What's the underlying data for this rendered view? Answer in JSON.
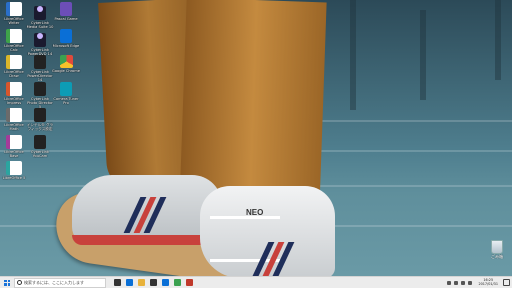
{
  "desktop": {
    "icons": [
      {
        "label": "LibreOffice Writer",
        "icon": "libreoffice-writer-icon",
        "cls": "lo-writer"
      },
      {
        "label": "CyberLink Media Suite 10",
        "icon": "cyberlink-media-suite-icon",
        "cls": "cyber"
      },
      {
        "label": "Pascal Game",
        "icon": "pascal-game-icon",
        "cls": "ps"
      },
      {
        "label": "LibreOffice Calc",
        "icon": "libreoffice-calc-icon",
        "cls": "lo-calc"
      },
      {
        "label": "CyberLink PowerDVD 14",
        "icon": "cyberlink-powerdvd-icon",
        "cls": "cyber"
      },
      {
        "label": "Microsoft Edge",
        "icon": "microsoft-edge-icon",
        "cls": "edge"
      },
      {
        "label": "LibreOffice Draw",
        "icon": "libreoffice-draw-icon",
        "cls": "lo-draw"
      },
      {
        "label": "CyberLink PowerDirector 14",
        "icon": "cyberlink-powerdirector-icon",
        "cls": "prem"
      },
      {
        "label": "Google Chrome",
        "icon": "google-chrome-icon",
        "cls": "chrome"
      },
      {
        "label": "LibreOffice Impress",
        "icon": "libreoffice-impress-icon",
        "cls": "lo-impress"
      },
      {
        "label": "CyberLink Photo Director 5",
        "icon": "cyberlink-photodirector-icon",
        "cls": "prem"
      },
      {
        "label": "Camera Tuner Pro",
        "icon": "camera-app-icon",
        "cls": "cam"
      },
      {
        "label": "LibreOffice Math",
        "icon": "libreoffice-math-icon",
        "cls": "lo-math"
      },
      {
        "label": "インテル® グラフィックス設定",
        "icon": "cyberlink-app-icon",
        "cls": "prem"
      },
      {
        "label": "LibreOffice Base",
        "icon": "libreoffice-base-icon",
        "cls": "lo-base"
      },
      {
        "label": "CyberLink YouCam",
        "icon": "cyberlink-youcam-icon",
        "cls": "prem"
      },
      {
        "label": "LibreOffice 5",
        "icon": "libreoffice-icon",
        "cls": "lo-main"
      }
    ],
    "recycle_bin": {
      "label": "ごみ箱",
      "icon": "recycle-bin-icon"
    },
    "wallpaper": {
      "logo_text": "NEO"
    }
  },
  "taskbar": {
    "search_placeholder": "検索するには、ここに入力します",
    "pinned": [
      {
        "icon": "task-view-icon",
        "color": "#333333"
      },
      {
        "icon": "edge-taskbar-icon",
        "color": "#0a6fd6"
      },
      {
        "icon": "file-explorer-icon",
        "color": "#e8b23a"
      },
      {
        "icon": "store-icon",
        "color": "#333333"
      },
      {
        "icon": "mail-icon",
        "color": "#0a6fd6"
      },
      {
        "icon": "chrome-taskbar-icon",
        "color": "#3ba150"
      },
      {
        "icon": "media-icon",
        "color": "#c0392b"
      }
    ],
    "clock_time": "16:25",
    "clock_date": "2017/01/31"
  }
}
